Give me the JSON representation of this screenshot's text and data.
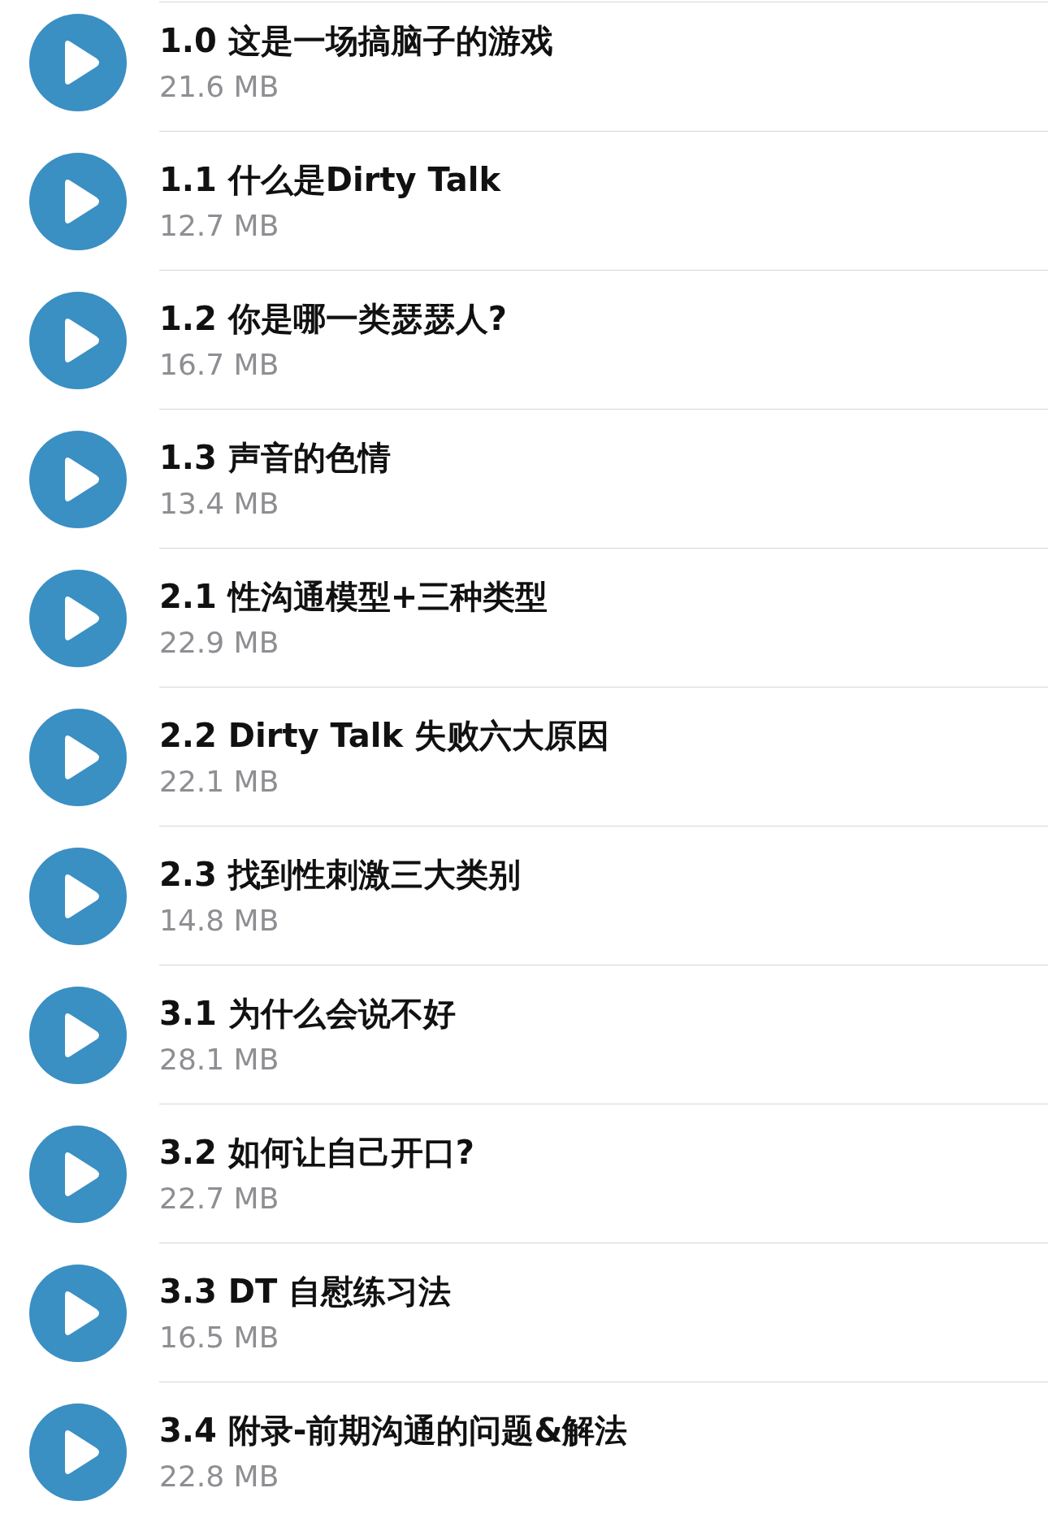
{
  "tracks": [
    {
      "title": "1.0 这是一场搞脑子的游戏",
      "size": "21.6 MB"
    },
    {
      "title": "1.1 什么是Dirty Talk",
      "size": "12.7 MB"
    },
    {
      "title": "1.2 你是哪一类瑟瑟人?",
      "size": "16.7 MB"
    },
    {
      "title": "1.3 声音的色情",
      "size": "13.4 MB"
    },
    {
      "title": "2.1 性沟通模型+三种类型",
      "size": "22.9 MB"
    },
    {
      "title": "2.2 Dirty Talk 失败六大原因",
      "size": "22.1 MB"
    },
    {
      "title": "2.3 找到性刺激三大类别",
      "size": "14.8 MB"
    },
    {
      "title": "3.1 为什么会说不好",
      "size": "28.1 MB"
    },
    {
      "title": "3.2 如何让自己开口?",
      "size": "22.7 MB"
    },
    {
      "title": "3.3 DT 自慰练习法",
      "size": "16.5 MB"
    },
    {
      "title": "3.4 附录-前期沟通的问题&解法",
      "size": "22.8 MB"
    }
  ]
}
